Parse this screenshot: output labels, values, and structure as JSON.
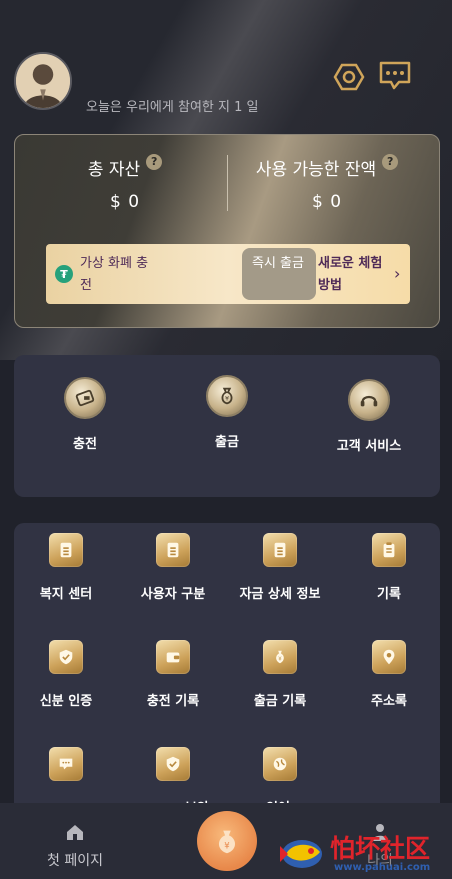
{
  "header": {
    "days_text": "오늘은 우리에게 참여한 지 1 일",
    "settings_icon": "hexagon-settings-icon",
    "message_icon": "message-bubble-icon"
  },
  "assets": {
    "total_label": "총 자산",
    "total_value": "$ 0",
    "available_label": "사용 가능한 잔액",
    "available_value": "$ 0",
    "help_mark": "?",
    "promo": {
      "tether_symbol": "₮",
      "crypto_recharge": "가상 화폐 충전",
      "instant_withdraw": "즉시 출금",
      "new_experience": "새로운 체험 방법",
      "chevron": "›"
    }
  },
  "quick_actions": [
    {
      "label": "충전",
      "icon": "wallet-card-icon"
    },
    {
      "label": "출금",
      "icon": "money-bag-icon"
    },
    {
      "label": "고객 서비스",
      "icon": "headset-icon"
    }
  ],
  "menu_items": [
    {
      "label": "복지 센터",
      "icon": "document-icon"
    },
    {
      "label": "사용자 구분",
      "icon": "document-icon"
    },
    {
      "label": "자금 상세 정보",
      "icon": "document-icon"
    },
    {
      "label": "기록",
      "icon": "clipboard-icon"
    },
    {
      "label": "신분 인증",
      "icon": "shield-check-icon"
    },
    {
      "label": "충전 기록",
      "icon": "wallet-icon"
    },
    {
      "label": "출금 기록",
      "icon": "money-bag-icon"
    },
    {
      "label": "주소록",
      "icon": "location-pin-icon"
    },
    {
      "label": "",
      "icon": "message-icon"
    },
    {
      "label": "보안",
      "icon": "shield-check-icon"
    },
    {
      "label": "언어",
      "icon": "globe-icon"
    }
  ],
  "tabbar": {
    "home_label": "첫 페이지",
    "center_symbol": "¥",
    "mine_label": "나의"
  },
  "watermark": {
    "main": "怕坏社区",
    "sub": "www.pahuai.com"
  },
  "colors": {
    "background": "#20222b",
    "panel": "#313343",
    "gold": "#cda25a",
    "promo_text": "#4e2a57"
  }
}
